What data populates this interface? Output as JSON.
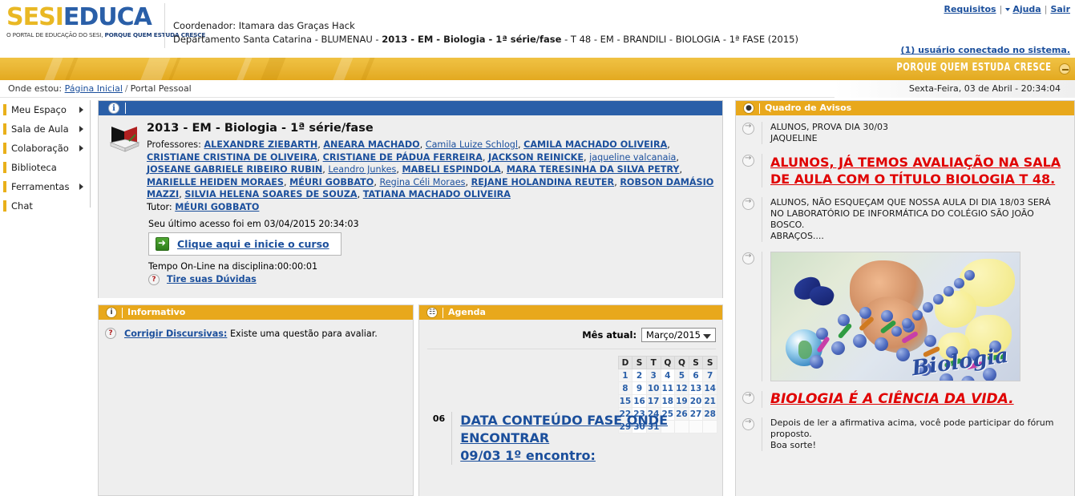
{
  "header": {
    "logo_main_1": "SESI",
    "logo_main_2": "EDUCA",
    "logo_sub_plain": "O PORTAL DE EDUCAÇÃO DO SESI, ",
    "logo_sub_bold": "PORQUE QUEM ESTUDA CRESCE",
    "coordinator_line": "Coordenador: Itamara das Graças Hack",
    "department_prefix": "Departamento Santa Catarina - BLUMENAU - ",
    "department_bold": "2013 - EM - Biologia - 1ª série/fase",
    "department_suffix": " - T 48 - EM - BRANDILI - BIOLOGIA - 1ª FASE (2015)",
    "links": {
      "requisitos": "Requisitos",
      "ajuda": "Ajuda",
      "sair": "Sair"
    },
    "connected": "(1) usuário conectado no sistema.",
    "band_slogan": "PORQUE QUEM ESTUDA CRESCE"
  },
  "breadcrumb": {
    "label": "Onde estou:",
    "link": "Página Inicial",
    "current": "Portal Pessoal",
    "clock": "Sexta-Feira, 03 de Abril - 20:34:04"
  },
  "sidebar": {
    "items": [
      {
        "label": "Meu Espaço",
        "has_arrow": true
      },
      {
        "label": "Sala de Aula",
        "has_arrow": true
      },
      {
        "label": "Colaboração",
        "has_arrow": true
      },
      {
        "label": "Biblioteca",
        "has_arrow": false
      },
      {
        "label": "Ferramentas",
        "has_arrow": true
      },
      {
        "label": "Chat",
        "has_arrow": false
      }
    ]
  },
  "main_panel": {
    "icon": "info-icon",
    "course_title": "2013 - EM - Biologia - 1ª série/fase",
    "professors_label": "Professores:",
    "professors": [
      {
        "name": "ALEXANDRE ZIEBARTH",
        "upper": true
      },
      {
        "name": "ANEARA MACHADO",
        "upper": true
      },
      {
        "name": "Camila Luize Schlogl",
        "upper": false
      },
      {
        "name": "CAMILA MACHADO OLIVEIRA",
        "upper": true
      },
      {
        "name": "CRISTIANE CRISTINA DE OLIVEIRA",
        "upper": true
      },
      {
        "name": "CRISTIANE DE PÁDUA FERREIRA",
        "upper": true
      },
      {
        "name": "JACKSON REINICKE",
        "upper": true
      },
      {
        "name": "jaqueline valcanaia",
        "upper": false
      },
      {
        "name": "JOSEANE GABRIELE RIBEIRO RUBIN",
        "upper": true
      },
      {
        "name": "Leandro Junkes",
        "upper": false
      },
      {
        "name": "MABELI ESPINDOLA",
        "upper": true
      },
      {
        "name": "MARA TERESINHA DA SILVA PETRY",
        "upper": true
      },
      {
        "name": "MARIELLE HEIDEN MORAES",
        "upper": true
      },
      {
        "name": "MÉURI GOBBATO",
        "upper": true
      },
      {
        "name": "Regina Céli Moraes",
        "upper": false
      },
      {
        "name": "REJANE HOLANDINA REUTER",
        "upper": true
      },
      {
        "name": "ROBSON DAMÁSIO MAZZI",
        "upper": true
      },
      {
        "name": "SILVIA HELENA SOARES DE SOUZA",
        "upper": true
      },
      {
        "name": "TATIANA MACHADO OLIVEIRA",
        "upper": true
      }
    ],
    "tutor_label": "Tutor:",
    "tutor_name": "MÉURI GOBBATO",
    "last_access": "Seu último acesso foi em 03/04/2015 20:34:03",
    "start_course_link": "Clique aqui e inicie o curso",
    "online_time": "Tempo On-Line na disciplina:00:00:01",
    "doubts_link": "Tire suas Dúvidas"
  },
  "informativo": {
    "title": "Informativo",
    "icon": "info-icon",
    "entry_link": "Corrigir Discursivas:",
    "entry_text": " Existe uma questão para avaliar."
  },
  "agenda": {
    "title": "Agenda",
    "icon": "calendar-icon",
    "month_label": "Mês atual:",
    "month_value": "Março/2015",
    "weekday_headers": [
      "D",
      "S",
      "T",
      "Q",
      "Q",
      "S",
      "S"
    ],
    "weeks": [
      [
        "1",
        "2",
        "3",
        "4",
        "5",
        "6",
        "7"
      ],
      [
        "8",
        "9",
        "10",
        "11",
        "12",
        "13",
        "14"
      ],
      [
        "15",
        "16",
        "17",
        "18",
        "19",
        "20",
        "21"
      ],
      [
        "22",
        "23",
        "24",
        "25",
        "26",
        "27",
        "28"
      ],
      [
        "29",
        "30",
        "31",
        "",
        "",
        "",
        ""
      ]
    ],
    "entry": {
      "day": "06",
      "title": "DATA CONTEÚDO FASE ONDE ENCONTRAR",
      "subtitle": "09/03 1º encontro:"
    }
  },
  "avisos": {
    "title": "Quadro de Avisos",
    "icon": "pin-icon",
    "items": [
      {
        "type": "plain",
        "lines": [
          "ALUNOS, PROVA DIA 30/03",
          "JAQUELINE"
        ]
      },
      {
        "type": "red",
        "italic": false,
        "lines": [
          "ALUNOS, JÁ TEMOS AVALIAÇÃO NA SALA DE AULA COM O TÍTULO BIOLOGIA T 48."
        ]
      },
      {
        "type": "plain",
        "lines": [
          "ALUNOS, NÃO ESQUEÇAM QUE NOSSA AULA DI DIA 18/03 SERÁ NO LABORATÓRIO DE INFORMÁTICA DO COLÉGIO SÃO JOÃO BOSCO.",
          "ABRAÇOS...."
        ]
      },
      {
        "type": "image",
        "image_name": "biologia-dna-illustration",
        "image_caption": "Biologia"
      },
      {
        "type": "red",
        "italic": true,
        "lines": [
          "BIOLOGIA É A CIÊNCIA DA VIDA."
        ]
      },
      {
        "type": "plain",
        "lines": [
          "Depois de ler a afirmativa acima, você pode participar do fórum proposto.",
          "Boa sorte!"
        ]
      }
    ]
  },
  "colors": {
    "brand_orange": "#e8a81c",
    "brand_blue": "#2a5fa8",
    "link_blue": "#1b4f9c",
    "alert_red": "#e00000",
    "logo_yellow": "#e9b824"
  }
}
